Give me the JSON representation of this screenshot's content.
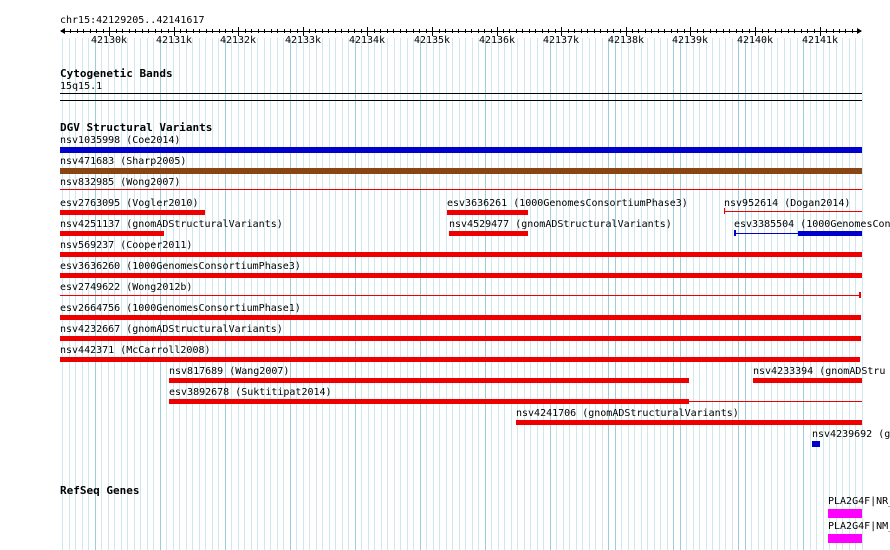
{
  "ruler": {
    "location": "chr15:42129205..42141617",
    "ticks": [
      "42130k",
      "42131k",
      "42132k",
      "42133k",
      "42134k",
      "42135k",
      "42136k",
      "42137k",
      "42138k",
      "42139k",
      "42140k",
      "42141k"
    ]
  },
  "tracks": {
    "cytobands": {
      "title": "Cytogenetic Bands",
      "band": "15q15.1"
    },
    "dgv": {
      "title": "DGV Structural Variants"
    },
    "refseq": {
      "title": "RefSeq Genes"
    }
  },
  "features": [
    {
      "label": "nsv1035998 (Coe2014)",
      "color": "#0000cc"
    },
    {
      "label": "nsv471683 (Sharp2005)",
      "color": "#8b4513"
    },
    {
      "label": "nsv832985 (Wong2007)",
      "color": "#ee0000"
    },
    {
      "label": "esv2763095 (Vogler2010)",
      "color": "#ee0000"
    },
    {
      "label": "esv3636261 (1000GenomesConsortiumPhase3)",
      "color": "#ee0000"
    },
    {
      "label": "nsv952614 (Dogan2014)",
      "color": "#ee0000"
    },
    {
      "label": "nsv4251137 (gnomADStructuralVariants)",
      "color": "#ee0000"
    },
    {
      "label": "nsv4529477 (gnomADStructuralVariants)",
      "color": "#ee0000"
    },
    {
      "label": "esv3385504 (1000GenomesCon",
      "color": "#0000cc"
    },
    {
      "label": "nsv569237 (Cooper2011)",
      "color": "#ee0000"
    },
    {
      "label": "esv3636260 (1000GenomesConsortiumPhase3)",
      "color": "#ee0000"
    },
    {
      "label": "esv2749622 (Wong2012b)",
      "color": "#ee0000"
    },
    {
      "label": "esv2664756 (1000GenomesConsortiumPhase1)",
      "color": "#ee0000"
    },
    {
      "label": "nsv4232667 (gnomADStructuralVariants)",
      "color": "#ee0000"
    },
    {
      "label": "nsv442371 (McCarroll2008)",
      "color": "#ee0000"
    },
    {
      "label": "nsv817689 (Wang2007)",
      "color": "#ee0000"
    },
    {
      "label": "nsv4233394 (gnomADStru",
      "color": "#ee0000"
    },
    {
      "label": "esv3892678 (Suktitipat2014)",
      "color": "#ee0000"
    },
    {
      "label": "nsv4241706 (gnomADStructuralVariants)",
      "color": "#ee0000"
    },
    {
      "label": "nsv4239692 (g",
      "color": "#0000cc"
    },
    {
      "label": "PLA2G4F|NR_",
      "color": "#ff00ff"
    },
    {
      "label": "PLA2G4F|NM_",
      "color": "#ff00ff"
    }
  ]
}
